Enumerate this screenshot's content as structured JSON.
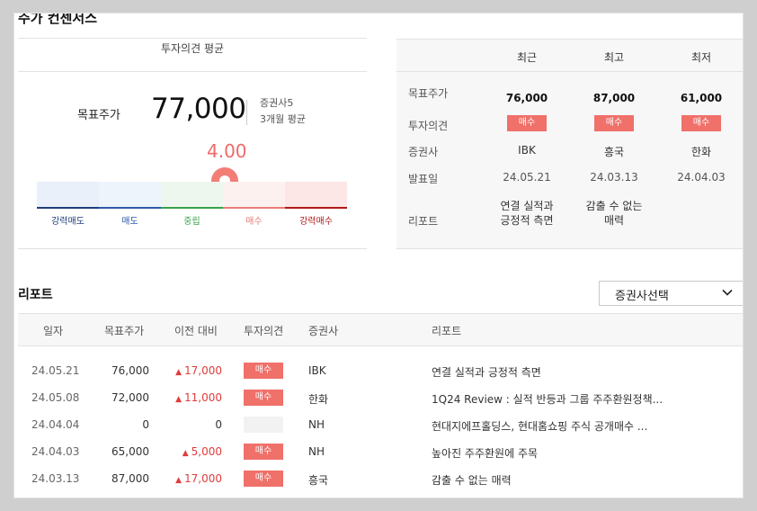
{
  "section_title": "주가 컨센서스",
  "average": {
    "header": "투자의견 평균",
    "target_label": "목표주가",
    "target_value": "77,000",
    "brokers": "증권사5",
    "period": "3개월 평균",
    "score": "4.00",
    "scale": [
      "강력매도",
      "매도",
      "중립",
      "매수",
      "강력매수"
    ]
  },
  "summary": {
    "columns": [
      "최근",
      "최고",
      "최저"
    ],
    "row_labels": [
      "목표주가",
      "투자의견",
      "증권사",
      "발표일",
      "리포트"
    ],
    "target_prices": [
      "76,000",
      "87,000",
      "61,000"
    ],
    "opinions": [
      "매수",
      "매수",
      "매수"
    ],
    "brokers": [
      "IBK",
      "흥국",
      "한화"
    ],
    "dates": [
      "24.05.21",
      "24.03.13",
      "24.04.03"
    ],
    "reports": [
      [
        "연결 실적과",
        "긍정적 측면"
      ],
      [
        "감출 수 없는",
        "매력"
      ],
      [
        "",
        ""
      ]
    ]
  },
  "reports": {
    "title": "리포트",
    "broker_select": "증권사선택",
    "headers": [
      "일자",
      "목표주가",
      "이전 대비",
      "투자의견",
      "증권사",
      "리포트"
    ],
    "rows": [
      {
        "date": "24.05.21",
        "target": "76,000",
        "change": "17,000",
        "dir": "up",
        "opinion": "매수",
        "broker": "IBK",
        "title": "연결 실적과 긍정적 측면"
      },
      {
        "date": "24.05.08",
        "target": "72,000",
        "change": "11,000",
        "dir": "up",
        "opinion": "매수",
        "broker": "한화",
        "title": "1Q24 Review : 실적 반등과 그룹 주주환원정책..."
      },
      {
        "date": "24.04.04",
        "target": "0",
        "change": "0",
        "dir": "none",
        "opinion": "",
        "broker": "NH",
        "title": "현대지에프홀딩스, 현대홈쇼핑 주식 공개매수 ..."
      },
      {
        "date": "24.04.03",
        "target": "65,000",
        "change": "5,000",
        "dir": "up",
        "opinion": "매수",
        "broker": "NH",
        "title": "높아진 주주환원에 주목"
      },
      {
        "date": "24.03.13",
        "target": "87,000",
        "change": "17,000",
        "dir": "up",
        "opinion": "매수",
        "broker": "흥국",
        "title": "감출 수 없는 매력"
      }
    ]
  }
}
